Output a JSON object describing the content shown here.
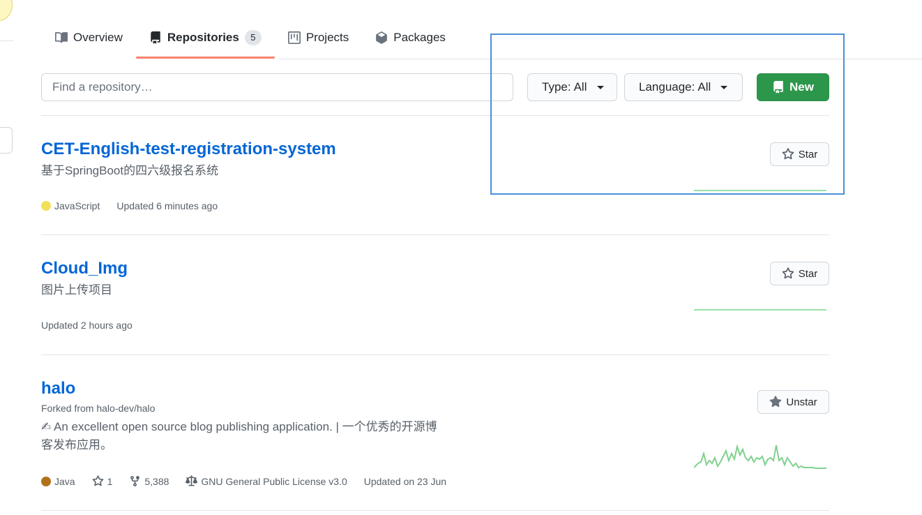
{
  "nav": {
    "tabs": [
      {
        "label": "Overview",
        "icon": "book-icon"
      },
      {
        "label": "Repositories",
        "icon": "repo-icon",
        "count": "5",
        "active": true
      },
      {
        "label": "Projects",
        "icon": "project-icon"
      },
      {
        "label": "Packages",
        "icon": "package-icon"
      }
    ]
  },
  "filters": {
    "search_placeholder": "Find a repository…",
    "type_label": "Type:",
    "type_value": "All",
    "language_label": "Language:",
    "language_value": "All",
    "new_label": "New"
  },
  "repos": [
    {
      "name": "CET-English-test-registration-system",
      "description": "基于SpringBoot的四六级报名系统",
      "language": "JavaScript",
      "language_color": "#f1e05a",
      "updated": "Updated 6 minutes ago",
      "star_label": "Star"
    },
    {
      "name": "Cloud_Img",
      "description": "图片上传项目",
      "updated": "Updated 2 hours ago",
      "star_label": "Star"
    },
    {
      "name": "halo",
      "forked_prefix": "Forked from ",
      "forked_from": "halo-dev/halo",
      "description_line1": "✍ An excellent open source blog publishing application. | 一个优秀的开源博",
      "description_line2": "客发布应用。",
      "language": "Java",
      "language_color": "#b07219",
      "stars": "1",
      "forks": "5,388",
      "license": "GNU General Public License v3.0",
      "updated": "Updated on 23 Jun",
      "star_label": "Unstar"
    }
  ],
  "colors": {
    "link": "#0366d6",
    "new_button": "#2c974b",
    "active_tab_underline": "#f9826c",
    "sparkline": "#7fd18f",
    "highlight_box": "#4a90d9"
  }
}
